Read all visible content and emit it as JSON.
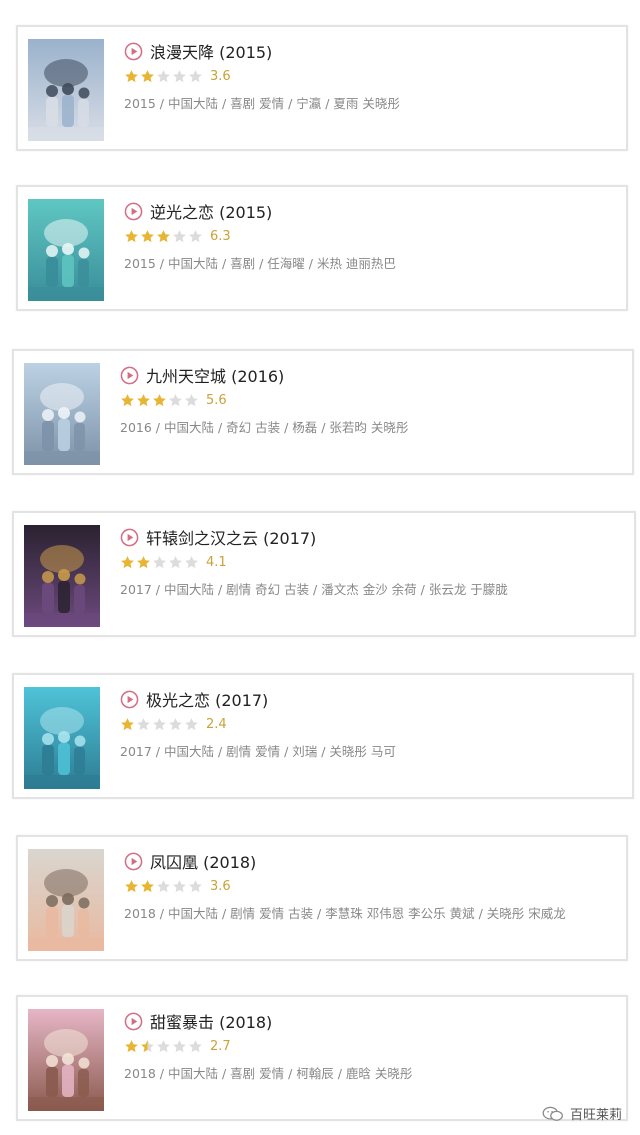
{
  "movies": [
    {
      "title": "浪漫天降 (2015)",
      "rating": 3.6,
      "rating_text": "3.6",
      "meta": "2015 / 中国大陆 / 喜剧 爱情 / 宁瀛 / 夏雨 关晓彤",
      "poster_colors": [
        "#9ab2cc",
        "#3e4a5c",
        "#d8dde6"
      ]
    },
    {
      "title": "逆光之恋 (2015)",
      "rating": 6.3,
      "rating_text": "6.3",
      "meta": "2015 / 中国大陆 / 喜剧 / 任海曜 / 米热 迪丽热巴",
      "poster_colors": [
        "#5fc7c2",
        "#e8f7f5",
        "#3a8d9a"
      ]
    },
    {
      "title": "九州天空城 (2016)",
      "rating": 5.6,
      "rating_text": "5.6",
      "meta": "2016 / 中国大陆 / 奇幻 古装 / 杨磊 / 张若昀 关晓彤",
      "poster_colors": [
        "#bcd2e4",
        "#eef3f8",
        "#7d92a8"
      ]
    },
    {
      "title": "轩辕剑之汉之云 (2017)",
      "rating": 4.1,
      "rating_text": "4.1",
      "meta": "2017 / 中国大陆 / 剧情 奇幻 古装 / 潘文杰 金沙 余荷 / 张云龙 于朦胧",
      "poster_colors": [
        "#2a2230",
        "#c89b4a",
        "#6d4a7e"
      ]
    },
    {
      "title": "极光之恋 (2017)",
      "rating": 2.4,
      "rating_text": "2.4",
      "meta": "2017 / 中国大陆 / 剧情 爱情 / 刘瑞 / 关晓彤 马可",
      "poster_colors": [
        "#4fc3d8",
        "#a9e4ef",
        "#2d7c93"
      ]
    },
    {
      "title": "凤囚凰 (2018)",
      "rating": 3.6,
      "rating_text": "3.6",
      "meta": "2018 / 中国大陆 / 剧情 爱情 古装 / 李慧珠 邓伟恩 李公乐 黄斌 / 关晓彤 宋威龙",
      "poster_colors": [
        "#d9d6cf",
        "#7a6a5e",
        "#e9b9a0"
      ]
    },
    {
      "title": "甜蜜暴击 (2018)",
      "rating": 2.7,
      "rating_text": "2.7",
      "meta": "2018 / 中国大陆 / 喜剧 爱情 / 柯翰辰 / 鹿晗 关晓彤",
      "poster_colors": [
        "#e6b6c7",
        "#f3e3d7",
        "#8a5a4e"
      ]
    }
  ],
  "watermark": {
    "text": "百旺莱莉",
    "icon": "wechat-icon"
  },
  "colors": {
    "star_filled": "#e7b531",
    "star_empty": "#dcdcdc",
    "play_icon": "#d46e84",
    "score": "#c9a23a"
  },
  "max_rating": 10
}
